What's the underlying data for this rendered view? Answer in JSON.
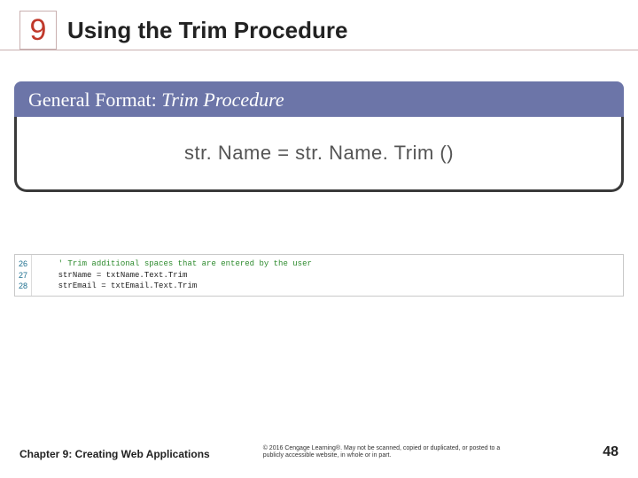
{
  "chapter_number": "9",
  "title": "Using the Trim Procedure",
  "figure": {
    "banner_prefix": "General Format:",
    "banner_topic": "Trim Procedure",
    "formula": "str. Name = str. Name. Trim ()"
  },
  "code": {
    "lines": [
      {
        "n": "26",
        "text": "' Trim additional spaces that are entered by the user",
        "cls": "cmt"
      },
      {
        "n": "27",
        "text": "strName = txtName.Text.Trim",
        "cls": "code-line"
      },
      {
        "n": "28",
        "text": "strEmail = txtEmail.Text.Trim",
        "cls": "code-line"
      }
    ]
  },
  "footer": {
    "chapter": "Chapter 9: Creating Web Applications",
    "copyright": "© 2016 Cengage Learning®. May not be scanned, copied or duplicated, or posted to a publicly accessible website, in whole or in part.",
    "page": "48"
  }
}
